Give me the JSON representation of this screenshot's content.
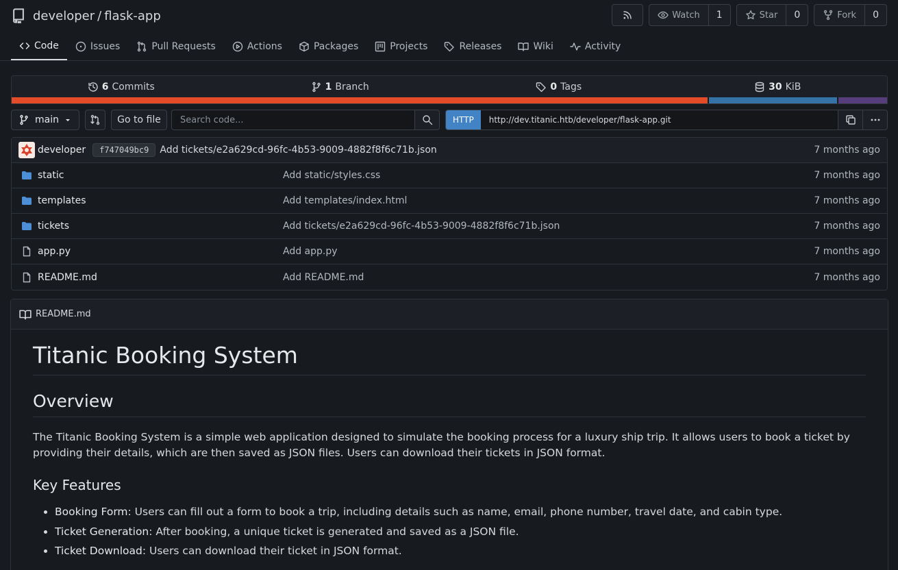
{
  "repo": {
    "owner": "developer",
    "separator": "/",
    "name": "flask-app"
  },
  "actions": {
    "watch_label": "Watch",
    "watch_count": "1",
    "star_label": "Star",
    "star_count": "0",
    "fork_label": "Fork",
    "fork_count": "0"
  },
  "tabs": [
    {
      "label": "Code",
      "icon": "code-icon",
      "active": true
    },
    {
      "label": "Issues",
      "icon": "issue-icon"
    },
    {
      "label": "Pull Requests",
      "icon": "pull-request-icon"
    },
    {
      "label": "Actions",
      "icon": "play-icon"
    },
    {
      "label": "Packages",
      "icon": "package-icon"
    },
    {
      "label": "Projects",
      "icon": "project-icon"
    },
    {
      "label": "Releases",
      "icon": "tag-icon"
    },
    {
      "label": "Wiki",
      "icon": "book-icon"
    },
    {
      "label": "Activity",
      "icon": "pulse-icon"
    }
  ],
  "stats": {
    "commits_count": "6",
    "commits_label": "Commits",
    "branches_count": "1",
    "branches_label": "Branch",
    "tags_count": "0",
    "tags_label": "Tags",
    "size_count": "30",
    "size_label": "KiB"
  },
  "language_bar": [
    {
      "color": "#e34c26",
      "fraction": 0.795
    },
    {
      "color": "#3572a5",
      "fraction": 0.148
    },
    {
      "color": "#563d7c",
      "fraction": 0.057
    }
  ],
  "toolbar": {
    "branch": "main",
    "go_to_file": "Go to file",
    "search_placeholder": "Search code...",
    "clone_protocol": "HTTP",
    "clone_url": "http://dev.titanic.htb/developer/flask-app.git"
  },
  "latest_commit": {
    "user": "developer",
    "sha": "f747049bc9",
    "message": "Add tickets/e2a629cd-96fc-4b53-9009-4882f8f6c71b.json",
    "age": "7 months ago"
  },
  "files": [
    {
      "name": "static",
      "type": "folder",
      "message": "Add static/styles.css",
      "age": "7 months ago"
    },
    {
      "name": "templates",
      "type": "folder",
      "message": "Add templates/index.html",
      "age": "7 months ago"
    },
    {
      "name": "tickets",
      "type": "folder",
      "message": "Add tickets/e2a629cd-96fc-4b53-9009-4882f8f6c71b.json",
      "age": "7 months ago"
    },
    {
      "name": "app.py",
      "type": "file",
      "message": "Add app.py",
      "age": "7 months ago"
    },
    {
      "name": "README.md",
      "type": "file",
      "message": "Add README.md",
      "age": "7 months ago"
    }
  ],
  "readme": {
    "filename": "README.md",
    "h1": "Titanic Booking System",
    "h2": "Overview",
    "overview": "The Titanic Booking System is a simple web application designed to simulate the booking process for a luxury ship trip. It allows users to book a ticket by providing their details, which are then saved as JSON files. Users can download their tickets in JSON format.",
    "h3": "Key Features",
    "features": [
      {
        "title": "Booking Form",
        "text": ": Users can fill out a form to book a trip, including details such as name, email, phone number, travel date, and cabin type."
      },
      {
        "title": "Ticket Generation",
        "text": ": After booking, a unique ticket is generated and saved as a JSON file."
      },
      {
        "title": "Ticket Download",
        "text": ": Users can download their ticket in JSON format."
      }
    ]
  }
}
